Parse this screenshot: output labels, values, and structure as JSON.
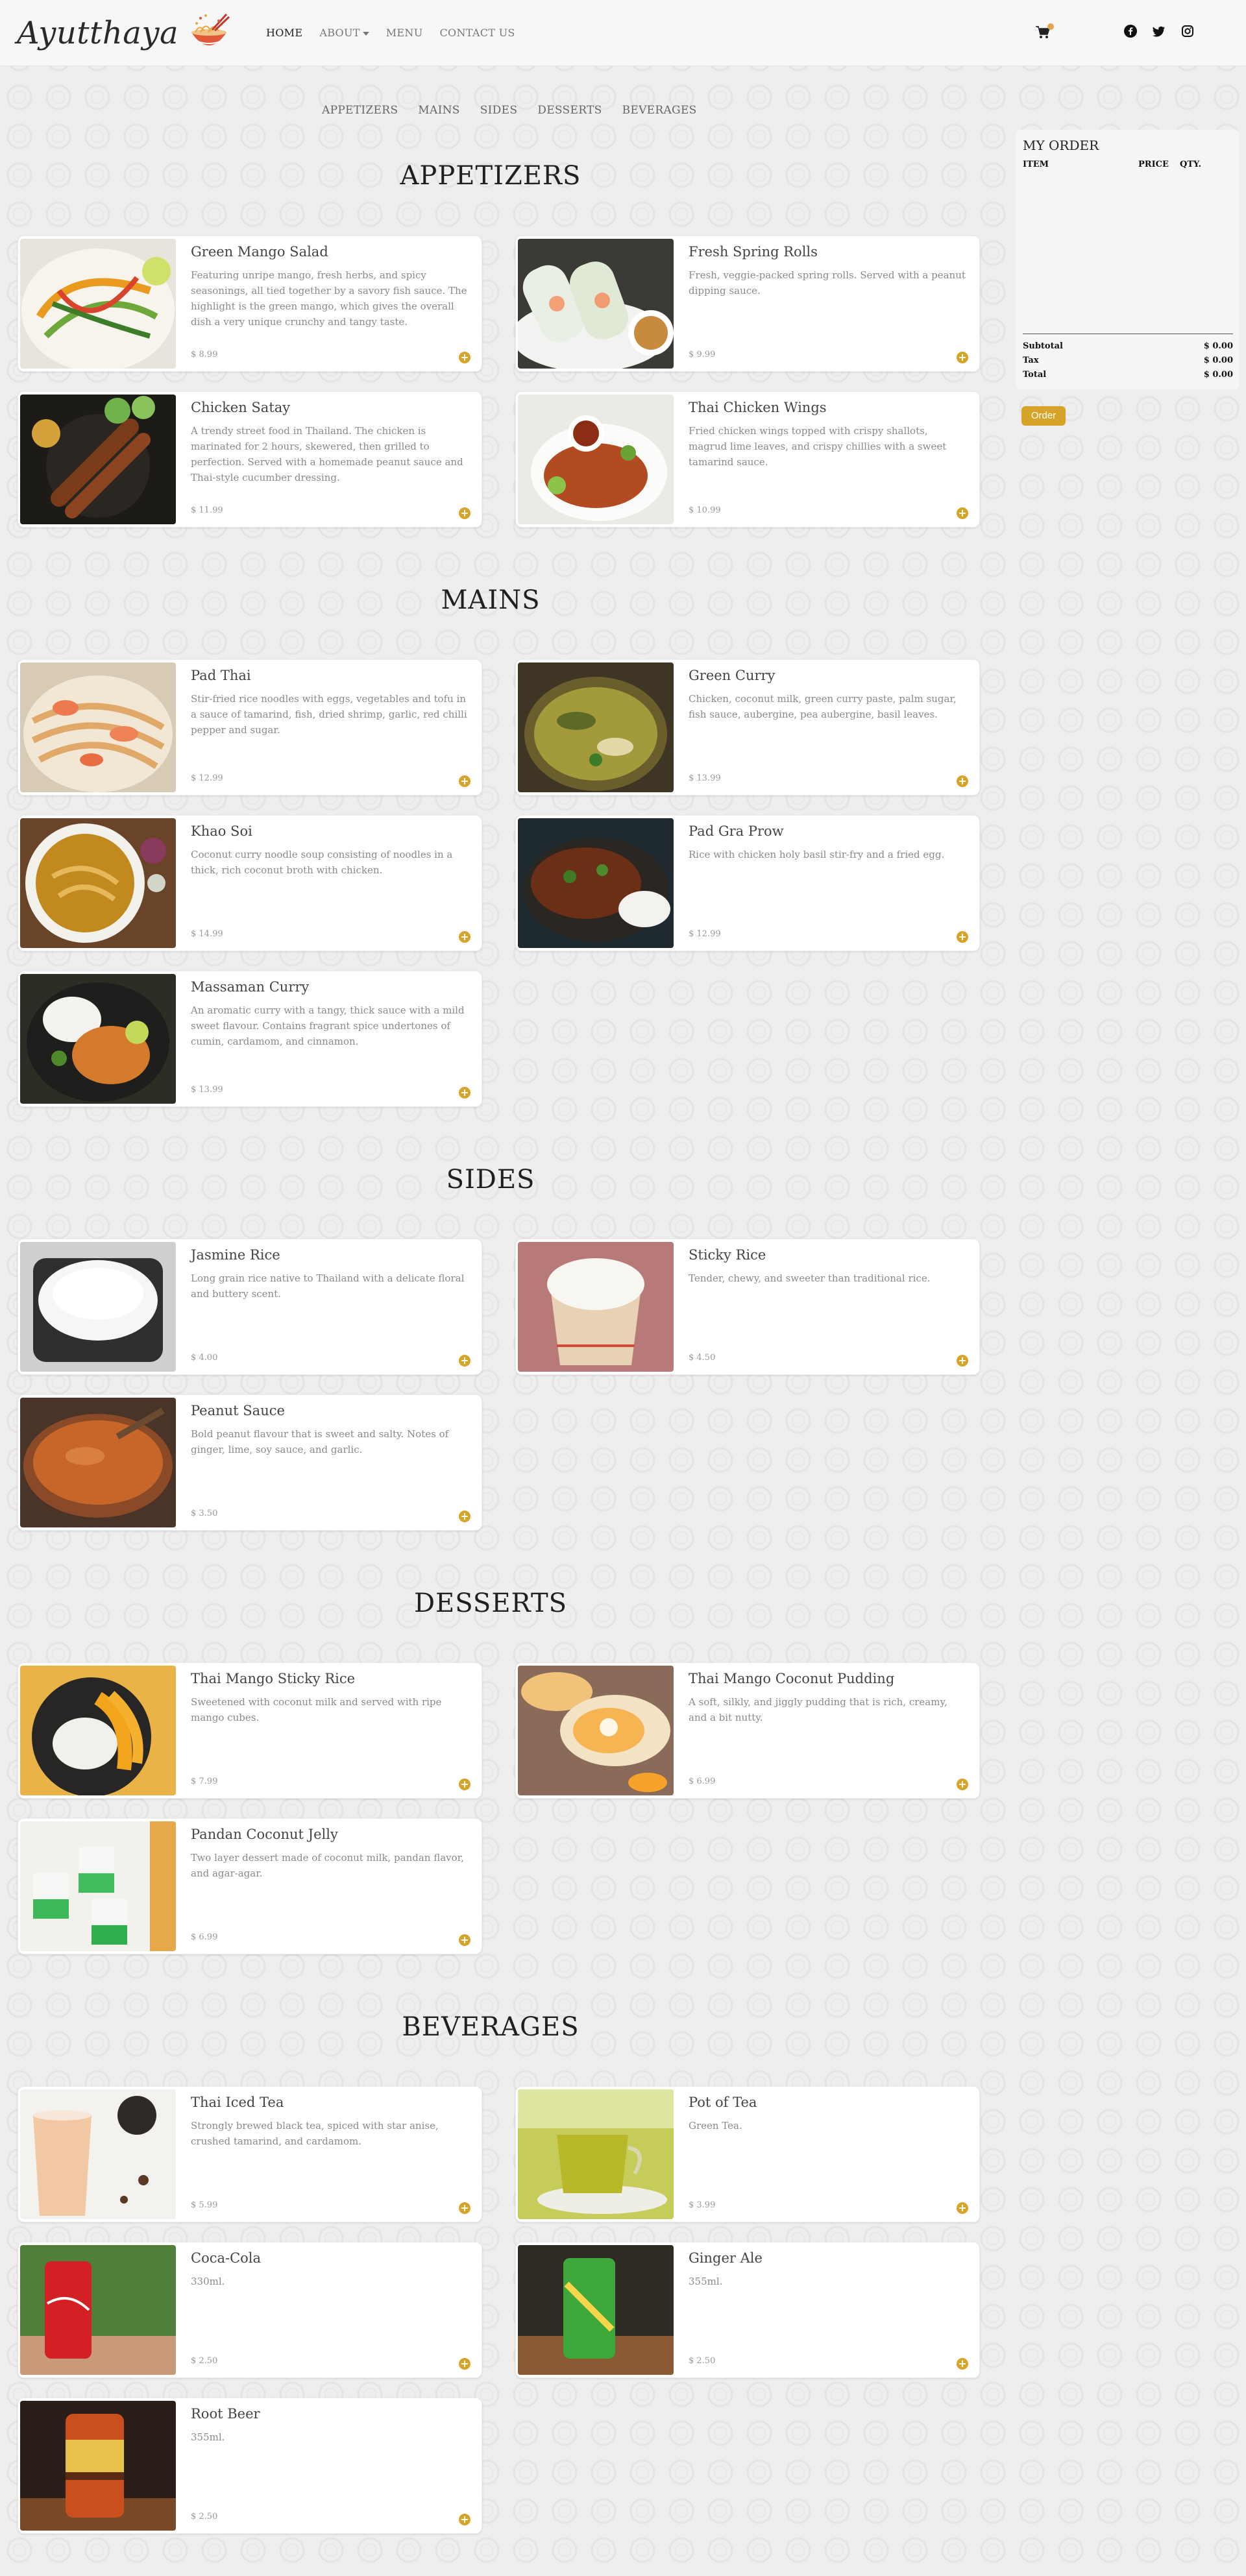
{
  "brand": {
    "name": "Ayutthaya",
    "logo_icon": "noodle-bowl-icon"
  },
  "nav": {
    "items": [
      "HOME",
      "ABOUT",
      "MENU",
      "CONTACT US"
    ],
    "active": "HOME"
  },
  "categories": [
    "APPETIZERS",
    "MAINS",
    "SIDES",
    "DESSERTS",
    "BEVERAGES"
  ],
  "sections": {
    "appetizers": {
      "title": "APPETIZERS",
      "items": [
        {
          "name": "Green Mango Salad",
          "desc": "Featuring unripe mango, fresh herbs, and spicy seasonings, all tied together by a savory fish sauce. The highlight is the green mango, which gives the overall dish a very unique crunchy and tangy taste.",
          "price": "$ 8.99"
        },
        {
          "name": "Fresh Spring Rolls",
          "desc": "Fresh, veggie-packed spring rolls. Served with a peanut dipping sauce.",
          "price": "$ 9.99"
        },
        {
          "name": "Chicken Satay",
          "desc": "A trendy street food in Thailand. The chicken is marinated for 2 hours, skewered, then grilled to perfection. Served with a homemade peanut sauce and Thai-style cucumber dressing.",
          "price": "$ 11.99"
        },
        {
          "name": "Thai Chicken Wings",
          "desc": "Fried chicken wings topped with crispy shallots, magrud lime leaves, and crispy chillies with a sweet tamarind sauce.",
          "price": "$ 10.99"
        }
      ]
    },
    "mains": {
      "title": "MAINS",
      "items": [
        {
          "name": "Pad Thai",
          "desc": "Stir-fried rice noodles with eggs, vegetables and tofu in a sauce of tamarind, fish, dried shrimp, garlic, red chilli pepper and sugar.",
          "price": "$ 12.99"
        },
        {
          "name": "Green Curry",
          "desc": "Chicken, coconut milk, green curry paste, palm sugar, fish sauce, aubergine, pea aubergine, basil leaves.",
          "price": "$ 13.99"
        },
        {
          "name": "Khao Soi",
          "desc": "Coconut curry noodle soup consisting of noodles in a thick, rich coconut broth with chicken.",
          "price": "$ 14.99"
        },
        {
          "name": "Pad Gra Prow",
          "desc": "Rice with chicken holy basil stir-fry and a fried egg.",
          "price": "$ 12.99"
        },
        {
          "name": "Massaman Curry",
          "desc": "An aromatic curry with a tangy, thick sauce with a mild sweet flavour. Contains fragrant spice undertones of cumin, cardamom, and cinnamon.",
          "price": "$ 13.99"
        }
      ]
    },
    "sides": {
      "title": "SIDES",
      "items": [
        {
          "name": "Jasmine Rice",
          "desc": "Long grain rice native to Thailand with a delicate floral and buttery scent.",
          "price": "$ 4.00"
        },
        {
          "name": "Sticky Rice",
          "desc": "Tender, chewy, and sweeter than traditional rice.",
          "price": "$ 4.50"
        },
        {
          "name": "Peanut Sauce",
          "desc": "Bold peanut flavour that is sweet and salty. Notes of ginger, lime, soy sauce, and garlic.",
          "price": "$ 3.50"
        }
      ]
    },
    "desserts": {
      "title": "DESSERTS",
      "items": [
        {
          "name": "Thai Mango Sticky Rice",
          "desc": "Sweetened with coconut milk and served with ripe mango cubes.",
          "price": "$ 7.99"
        },
        {
          "name": "Thai Mango Coconut Pudding",
          "desc": "A soft, silkly, and jiggly pudding that is rich, creamy, and a bit nutty.",
          "price": "$ 6.99"
        },
        {
          "name": "Pandan Coconut Jelly",
          "desc": "Two layer dessert made of coconut milk, pandan flavor, and agar-agar.",
          "price": "$ 6.99"
        }
      ]
    },
    "beverages": {
      "title": "BEVERAGES",
      "items": [
        {
          "name": "Thai Iced Tea",
          "desc": "Strongly brewed black tea, spiced with star anise, crushed tamarind, and cardamom.",
          "price": "$ 5.99"
        },
        {
          "name": "Pot of Tea",
          "desc": "Green Tea.",
          "price": "$ 3.99"
        },
        {
          "name": "Coca-Cola",
          "desc": "330ml.",
          "price": "$ 2.50"
        },
        {
          "name": "Ginger Ale",
          "desc": "355ml.",
          "price": "$ 2.50"
        },
        {
          "name": "Root Beer",
          "desc": "355ml.",
          "price": "$ 2.50"
        }
      ]
    }
  },
  "order": {
    "title": "MY ORDER",
    "columns": [
      "ITEM",
      "PRICE",
      "QTY."
    ],
    "subtotal_label": "Subtotal",
    "subtotal": "$ 0.00",
    "tax_label": "Tax",
    "tax": "$ 0.00",
    "total_label": "Total",
    "total": "$ 0.00",
    "button": "Order"
  },
  "colors": {
    "accent": "#d7a42a",
    "text": "#333333",
    "muted": "#8a8a8a",
    "card": "#ffffff"
  }
}
